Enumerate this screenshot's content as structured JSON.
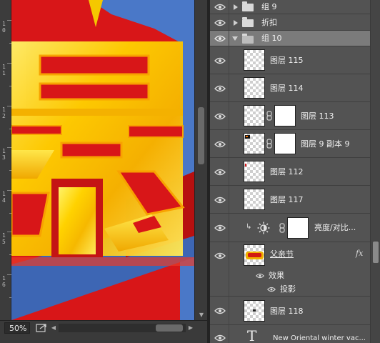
{
  "status": {
    "zoom": "50%"
  },
  "rulers": {
    "left_labels": [
      "1",
      "0",
      "1",
      "1",
      "1",
      "2",
      "1",
      "3",
      "1",
      "4",
      "1",
      "5",
      "1",
      "6"
    ]
  },
  "layers": [
    {
      "name": "组 9",
      "kind": "group",
      "expanded": false,
      "visible": true
    },
    {
      "name": "折扣",
      "kind": "group",
      "expanded": false,
      "visible": true
    },
    {
      "name": "组 10",
      "kind": "group",
      "expanded": true,
      "visible": true,
      "selected": true
    },
    {
      "name": "图层 115",
      "kind": "pixel",
      "visible": true
    },
    {
      "name": "图层 114",
      "kind": "pixel",
      "visible": true
    },
    {
      "name": "图层 113",
      "kind": "pixel-mask",
      "visible": true
    },
    {
      "name": "图层 9 副本 9",
      "kind": "pixel-mask",
      "visible": true
    },
    {
      "name": "图层 112",
      "kind": "pixel",
      "visible": true
    },
    {
      "name": "图层 117",
      "kind": "pixel",
      "visible": true
    },
    {
      "name": "亮度/对比...",
      "kind": "adjustment",
      "visible": true
    },
    {
      "name": "父亲节",
      "kind": "smart",
      "visible": true,
      "fx": "fx"
    },
    {
      "name": "效果",
      "kind": "effects",
      "visible": true
    },
    {
      "name": "投影",
      "kind": "effect",
      "visible": true
    },
    {
      "name": "图层 118",
      "kind": "pixel",
      "visible": true
    },
    {
      "name": "New Oriental winter vac...",
      "kind": "text",
      "visible": true
    }
  ],
  "colors": {
    "panel_bg": "#535353",
    "selected_row": "#7b7b7b",
    "artwork_red": "#d81618",
    "artwork_gold": "#f5c800",
    "artwork_blue": "#4a78c8"
  }
}
